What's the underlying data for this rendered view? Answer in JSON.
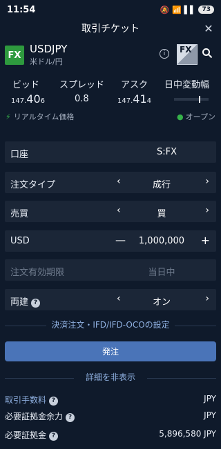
{
  "status_bar": {
    "time": "11:54",
    "icons": "🔕 📶 ▌▌",
    "battery": "73"
  },
  "header": {
    "title": "取引チケット",
    "close_glyph": "✕"
  },
  "symbol": {
    "badge": "FX",
    "name": "USDJPY",
    "subname": "米ドル/円",
    "info_glyph": "i",
    "fxo_label": "FX  O"
  },
  "quote": {
    "bid_label": "ビッド",
    "spread_label": "スプレッド",
    "ask_label": "アスク",
    "range_label": "日中変動幅",
    "bid_prefix": "147.",
    "bid_big": "40",
    "bid_small": "6",
    "spread": "0.8",
    "ask_prefix": "147.",
    "ask_big": "41",
    "ask_small": "4",
    "range_position": 0.72
  },
  "realtime": {
    "label": "リアルタイム価格",
    "status": "オープン"
  },
  "form": {
    "account_label": "口座",
    "account_value": "S:FX",
    "order_type_label": "注文タイプ",
    "order_type_value": "成行",
    "side_label": "売買",
    "side_value": "買",
    "quantity_label": "USD",
    "quantity_value": "1,000,000",
    "expiry_label": "注文有効期限",
    "expiry_value": "当日中",
    "hedge_label": "両建",
    "hedge_value": "オン"
  },
  "links": {
    "settlement": "決済注文・IFD/IFD-OCOの設定",
    "submit": "発注",
    "details": "詳細を非表示"
  },
  "details": [
    {
      "label": "取引手数料",
      "value": "JPY",
      "link": true
    },
    {
      "label": "必要証拠金余力",
      "value": "JPY",
      "link": false
    },
    {
      "label": "必要証拠金",
      "value": "5,896,580 JPY",
      "link": false
    }
  ],
  "colors": {
    "background": "#0f1a2b",
    "row": "#1b2637",
    "accent": "#4a74b8",
    "green": "#2e9a3e"
  }
}
